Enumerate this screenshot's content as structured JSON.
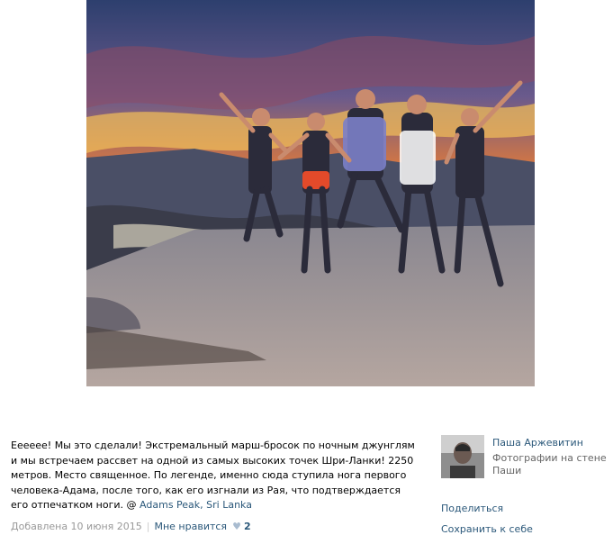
{
  "post": {
    "caption": "Ееееее! Мы это сделали! Экстремальный марш-бросок по ночным джунглям и мы встречаем рассвет на одной из самых высоких точек Шри-Ланки! 2250 метров. Место священное. По легенде, именно сюда ступила нога первого человека-Адама, после того, как его изгнали из Рая, что подтверждается его отпечатком ноги.",
    "location_prefix": "@",
    "location": "Adams Peak, Sri Lanka",
    "added": "Добавлена 10 июня 2015",
    "separator": "|",
    "like_label": "Мне нравится",
    "heart_glyph": "♥",
    "like_count": "2"
  },
  "author": {
    "name": "Паша Аржевитин",
    "subtitle": "Фотографии на стене Паши"
  },
  "actions": {
    "share": "Поделиться",
    "save": "Сохранить к себе"
  },
  "colors": {
    "link": "#2b587a",
    "muted": "#999999"
  }
}
